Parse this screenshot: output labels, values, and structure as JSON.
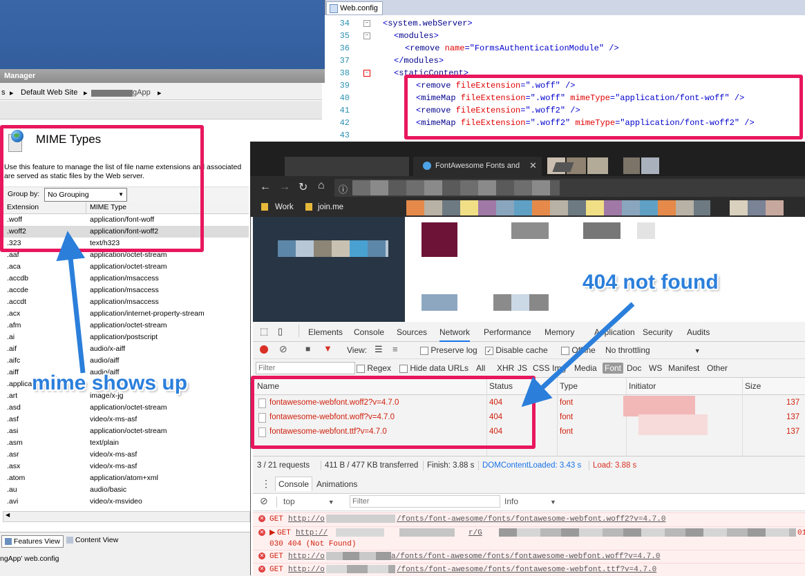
{
  "iis": {
    "title": "Manager",
    "breadcrumb": [
      "s",
      "Default Web Site",
      "gApp"
    ],
    "heading": "MIME Types",
    "description_line1": "Use this feature to manage the list of file name extensions and associated",
    "description_line2": "are served as static files by the Web server.",
    "group_by_label": "Group by:",
    "group_by_value": "No Grouping",
    "col_extension": "Extension",
    "col_mime": "MIME Type",
    "rows": [
      {
        "ext": ".woff",
        "mime": "application/font-woff"
      },
      {
        "ext": ".woff2",
        "mime": "application/font-woff2"
      },
      {
        "ext": ".323",
        "mime": "text/h323"
      },
      {
        "ext": ".aaf",
        "mime": "application/octet-stream"
      },
      {
        "ext": ".aca",
        "mime": "application/octet-stream"
      },
      {
        "ext": ".accdb",
        "mime": "application/msaccess"
      },
      {
        "ext": ".accde",
        "mime": "application/msaccess"
      },
      {
        "ext": ".accdt",
        "mime": "application/msaccess"
      },
      {
        "ext": ".acx",
        "mime": "application/internet-property-stream"
      },
      {
        "ext": ".afm",
        "mime": "application/octet-stream"
      },
      {
        "ext": ".ai",
        "mime": "application/postscript"
      },
      {
        "ext": ".aif",
        "mime": "audio/x-aiff"
      },
      {
        "ext": ".aifc",
        "mime": "audio/aiff"
      },
      {
        "ext": ".aiff",
        "mime": "audio/aiff"
      },
      {
        "ext": ".applica",
        "mime": ""
      },
      {
        "ext": ".art",
        "mime": "image/x-jg"
      },
      {
        "ext": ".asd",
        "mime": "application/octet-stream"
      },
      {
        "ext": ".asf",
        "mime": "video/x-ms-asf"
      },
      {
        "ext": ".asi",
        "mime": "application/octet-stream"
      },
      {
        "ext": ".asm",
        "mime": "text/plain"
      },
      {
        "ext": ".asr",
        "mime": "video/x-ms-asf"
      },
      {
        "ext": ".asx",
        "mime": "video/x-ms-asf"
      },
      {
        "ext": ".atom",
        "mime": "application/atom+xml"
      },
      {
        "ext": ".au",
        "mime": "audio/basic"
      },
      {
        "ext": ".avi",
        "mime": "video/x-msvideo"
      }
    ],
    "features_view": "Features View",
    "content_view": "Content View",
    "status": "ngApp' web.config"
  },
  "editor": {
    "tab": "Web.config",
    "lines": [
      {
        "n": "34",
        "parts": [
          [
            "bk",
            "<"
          ],
          [
            "tg",
            "system.webServer"
          ],
          [
            "bk",
            ">"
          ]
        ],
        "indent": 0
      },
      {
        "n": "35",
        "parts": [
          [
            "bk",
            "<"
          ],
          [
            "tg",
            "modules"
          ],
          [
            "bk",
            ">"
          ]
        ],
        "indent": 1
      },
      {
        "n": "36",
        "parts": [
          [
            "bk",
            "<"
          ],
          [
            "tg",
            "remove "
          ],
          [
            "an",
            "name"
          ],
          [
            "bk",
            "="
          ],
          [
            "av",
            "\"FormsAuthenticationModule\""
          ],
          [
            "bk",
            " />"
          ]
        ],
        "indent": 2
      },
      {
        "n": "37",
        "parts": [
          [
            "bk",
            "</"
          ],
          [
            "tg",
            "modules"
          ],
          [
            "bk",
            ">"
          ]
        ],
        "indent": 1
      },
      {
        "n": "38",
        "parts": [
          [
            "bk",
            "<"
          ],
          [
            "tg",
            "staticContent"
          ],
          [
            "bk",
            ">"
          ]
        ],
        "indent": 1
      },
      {
        "n": "39",
        "parts": [
          [
            "bk",
            "<"
          ],
          [
            "tg",
            "remove "
          ],
          [
            "an",
            "fileExtension"
          ],
          [
            "bk",
            "="
          ],
          [
            "av",
            "\".woff\""
          ],
          [
            "bk",
            " />"
          ]
        ],
        "indent": 3
      },
      {
        "n": "40",
        "parts": [
          [
            "bk",
            "<"
          ],
          [
            "tg",
            "mimeMap "
          ],
          [
            "an",
            "fileExtension"
          ],
          [
            "bk",
            "="
          ],
          [
            "av",
            "\".woff\""
          ],
          [
            "an",
            " mimeType"
          ],
          [
            "bk",
            "="
          ],
          [
            "av",
            "\"application/font-woff\""
          ],
          [
            "bk",
            " />"
          ]
        ],
        "indent": 3
      },
      {
        "n": "41",
        "parts": [
          [
            "bk",
            "<"
          ],
          [
            "tg",
            "remove "
          ],
          [
            "an",
            "fileExtension"
          ],
          [
            "bk",
            "="
          ],
          [
            "av",
            "\".woff2\""
          ],
          [
            "bk",
            " />"
          ]
        ],
        "indent": 3
      },
      {
        "n": "42",
        "parts": [
          [
            "bk",
            "<"
          ],
          [
            "tg",
            "mimeMap "
          ],
          [
            "an",
            "fileExtension"
          ],
          [
            "bk",
            "="
          ],
          [
            "av",
            "\".woff2\""
          ],
          [
            "an",
            " mimeType"
          ],
          [
            "bk",
            "="
          ],
          [
            "av",
            "\"application/font-woff2\""
          ],
          [
            "bk",
            " />"
          ]
        ],
        "indent": 3
      },
      {
        "n": "43",
        "parts": [],
        "indent": 0
      }
    ]
  },
  "chrome": {
    "tab_title": "FontAwesome Fonts and",
    "bookmarks": [
      "Work",
      "join.me"
    ],
    "devtools_tabs": [
      "Elements",
      "Console",
      "Sources",
      "Network",
      "Performance",
      "Memory",
      "Application",
      "Security",
      "Audits"
    ],
    "active_tab": "Network",
    "toolbar": {
      "view": "View:",
      "preserve_log": "Preserve log",
      "disable_cache": "Disable cache",
      "offline": "Offline",
      "throttling": "No throttling"
    },
    "filter": {
      "placeholder": "Filter",
      "regex": "Regex",
      "hide_data": "Hide data URLs",
      "types": [
        "All",
        "XHR",
        "JS",
        "CSS",
        "Img",
        "Media",
        "Font",
        "Doc",
        "WS",
        "Manifest",
        "Other"
      ],
      "active_type": "Font"
    },
    "columns": [
      "Name",
      "Status",
      "Type",
      "Initiator",
      "Size"
    ],
    "requests": [
      {
        "name": "fontawesome-webfont.woff2?v=4.7.0",
        "status": "404",
        "type": "font",
        "size": "137"
      },
      {
        "name": "fontawesome-webfont.woff?v=4.7.0",
        "status": "404",
        "type": "font",
        "size": "137"
      },
      {
        "name": "fontawesome-webfont.ttf?v=4.7.0",
        "status": "404",
        "type": "font",
        "size": "137"
      }
    ],
    "summary": {
      "requests": "3 / 21 requests",
      "transferred": "411 B / 477 KB transferred",
      "finish": "Finish: 3.88 s",
      "dcl": "DOMContentLoaded: 3.43 s",
      "load": "Load: 3.88 s"
    },
    "console_tabs": [
      "Console",
      "Animations"
    ],
    "console_context": "top",
    "console_filter": "Filter",
    "console_level": "Info",
    "errors": [
      {
        "method": "GET",
        "url_start": "http://o",
        "url_end": "/fonts/font-awesome/fonts/fontawesome-webfont.woff2?v=4.7.0",
        "extra": ""
      },
      {
        "method": "GET",
        "url_start": "http://",
        "url_end": "r/G",
        "extra": "030 404 (Not Found)",
        "tail": "01"
      },
      {
        "method": "GET",
        "url_start": "http://o",
        "url_end": "a/fonts/font-awesome/fonts/fontawesome-webfont.woff?v=4.7.0",
        "extra": ""
      },
      {
        "method": "GET",
        "url_start": "http://o",
        "url_end": "/fonts/font-awesome/fonts/fontawesome-webfont.ttf?v=4.7.0",
        "extra": ""
      }
    ]
  },
  "annotations": {
    "not_found": "404 not found",
    "mime": "mime shows up"
  },
  "colors": {
    "accent": "#e8175d",
    "arrow": "#2b7fdb",
    "error": "#d0200d"
  }
}
